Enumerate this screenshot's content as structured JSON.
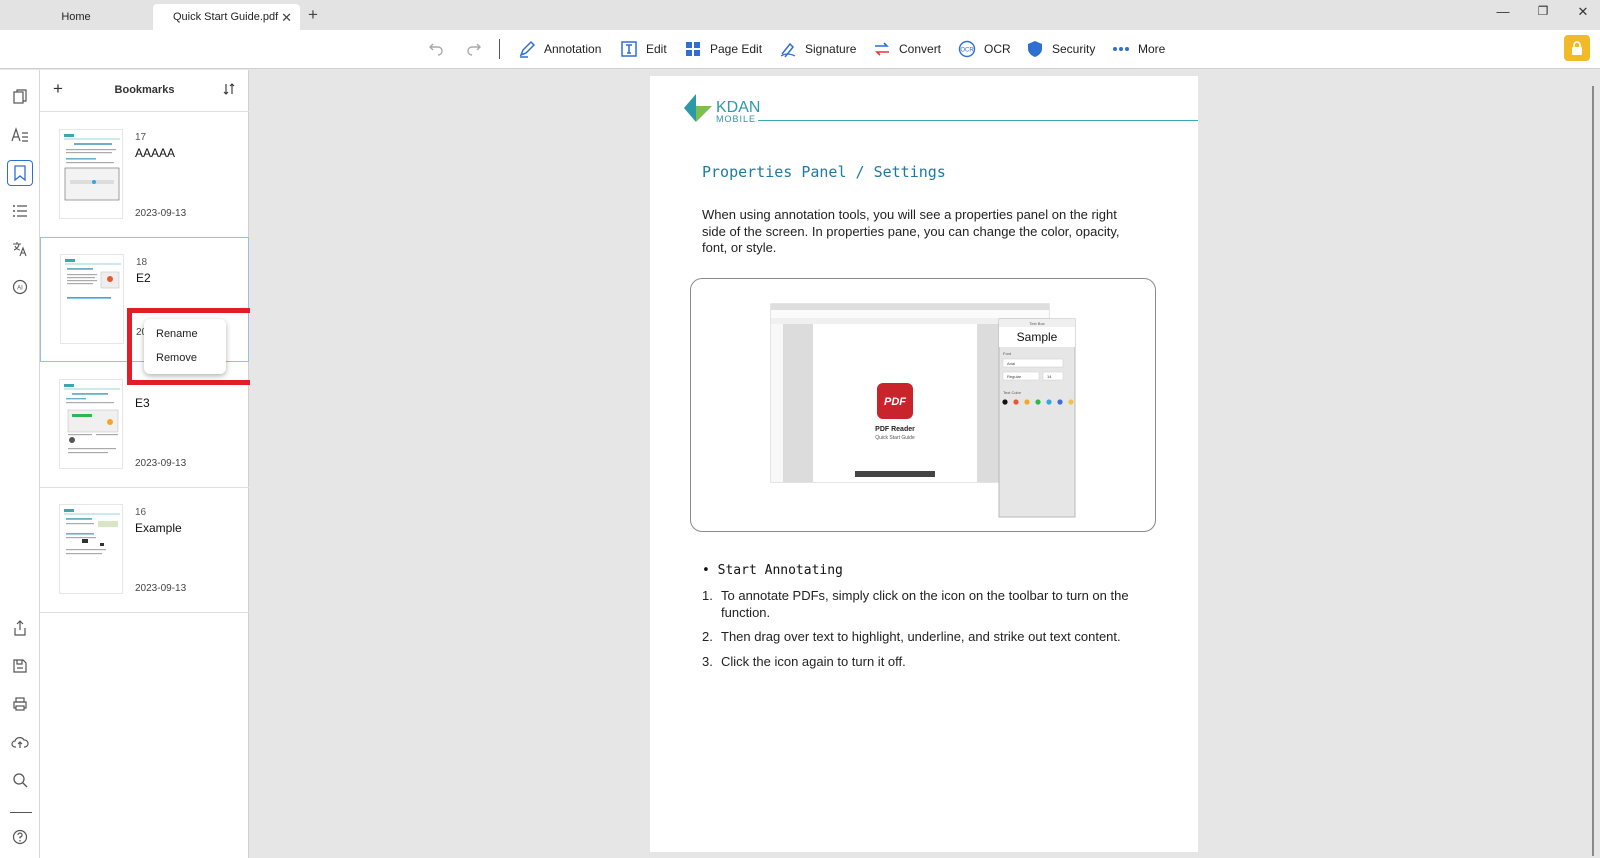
{
  "tabs": {
    "home_label": "Home",
    "active_label": "Quick Start Guide.pdf",
    "close_symbol": "✕",
    "new_symbol": "+"
  },
  "window_controls": {
    "minimize": "—",
    "restore": "❐",
    "close": "✕"
  },
  "toolbar": {
    "undo_icon": "undo-icon",
    "redo_icon": "redo-icon",
    "items": [
      {
        "label": "Annotation",
        "icon": "pen-icon"
      },
      {
        "label": "Edit",
        "icon": "edit-text-icon"
      },
      {
        "label": "Page Edit",
        "icon": "page-grid-icon"
      },
      {
        "label": "Signature",
        "icon": "signature-icon"
      },
      {
        "label": "Convert",
        "icon": "convert-arrows-icon"
      },
      {
        "label": "OCR",
        "icon": "ocr-icon"
      },
      {
        "label": "Security",
        "icon": "shield-icon"
      },
      {
        "label": "More",
        "icon": "more-dots-icon"
      }
    ],
    "accent_color": "#2f6fd1",
    "upgrade_color": "#f2b928"
  },
  "bookmarks": {
    "title": "Bookmarks",
    "add_symbol": "+",
    "items": [
      {
        "page": "17",
        "title": "AAAAA",
        "date": "2023-09-13"
      },
      {
        "page": "18",
        "title": "E2",
        "date": "20"
      },
      {
        "page": "",
        "title": "E3",
        "date": "2023-09-13"
      },
      {
        "page": "16",
        "title": "Example",
        "date": "2023-09-13"
      }
    ]
  },
  "context_menu": {
    "items": [
      "Rename",
      "Remove"
    ],
    "highlight_color": "#e31d25"
  },
  "document": {
    "logo_main": "KDAN",
    "logo_sub": "MOBILE",
    "heading": "Properties Panel / Settings",
    "paragraph": "When using annotation tools, you will see a properties panel on the right side of the screen. In properties pane, you can change the color, opacity, font, or style.",
    "screenshot": {
      "app_title": "PDF Reader",
      "app_subtitle": "Quick Start Guide",
      "app_badge": "PDF",
      "panel_heading": "Text Box",
      "panel_sample": "Sample",
      "font_label": "Font",
      "font_value": "Arial",
      "style_value": "Regular",
      "size_value": "14",
      "color_label": "Text Color",
      "swatches": [
        "#111111",
        "#e8582d",
        "#f5a623",
        "#2db84d",
        "#35a5e6",
        "#3b6fe0",
        "#f0c24b"
      ]
    },
    "subheading": "• Start Annotating",
    "steps": [
      {
        "n": "1.",
        "text": "To annotate PDFs, simply click on the icon on the toolbar to turn on the function."
      },
      {
        "n": "2.",
        "text": "Then drag over text to highlight, underline, and strike out text content."
      },
      {
        "n": "3.",
        "text": "Click the icon again to turn it off."
      }
    ]
  }
}
